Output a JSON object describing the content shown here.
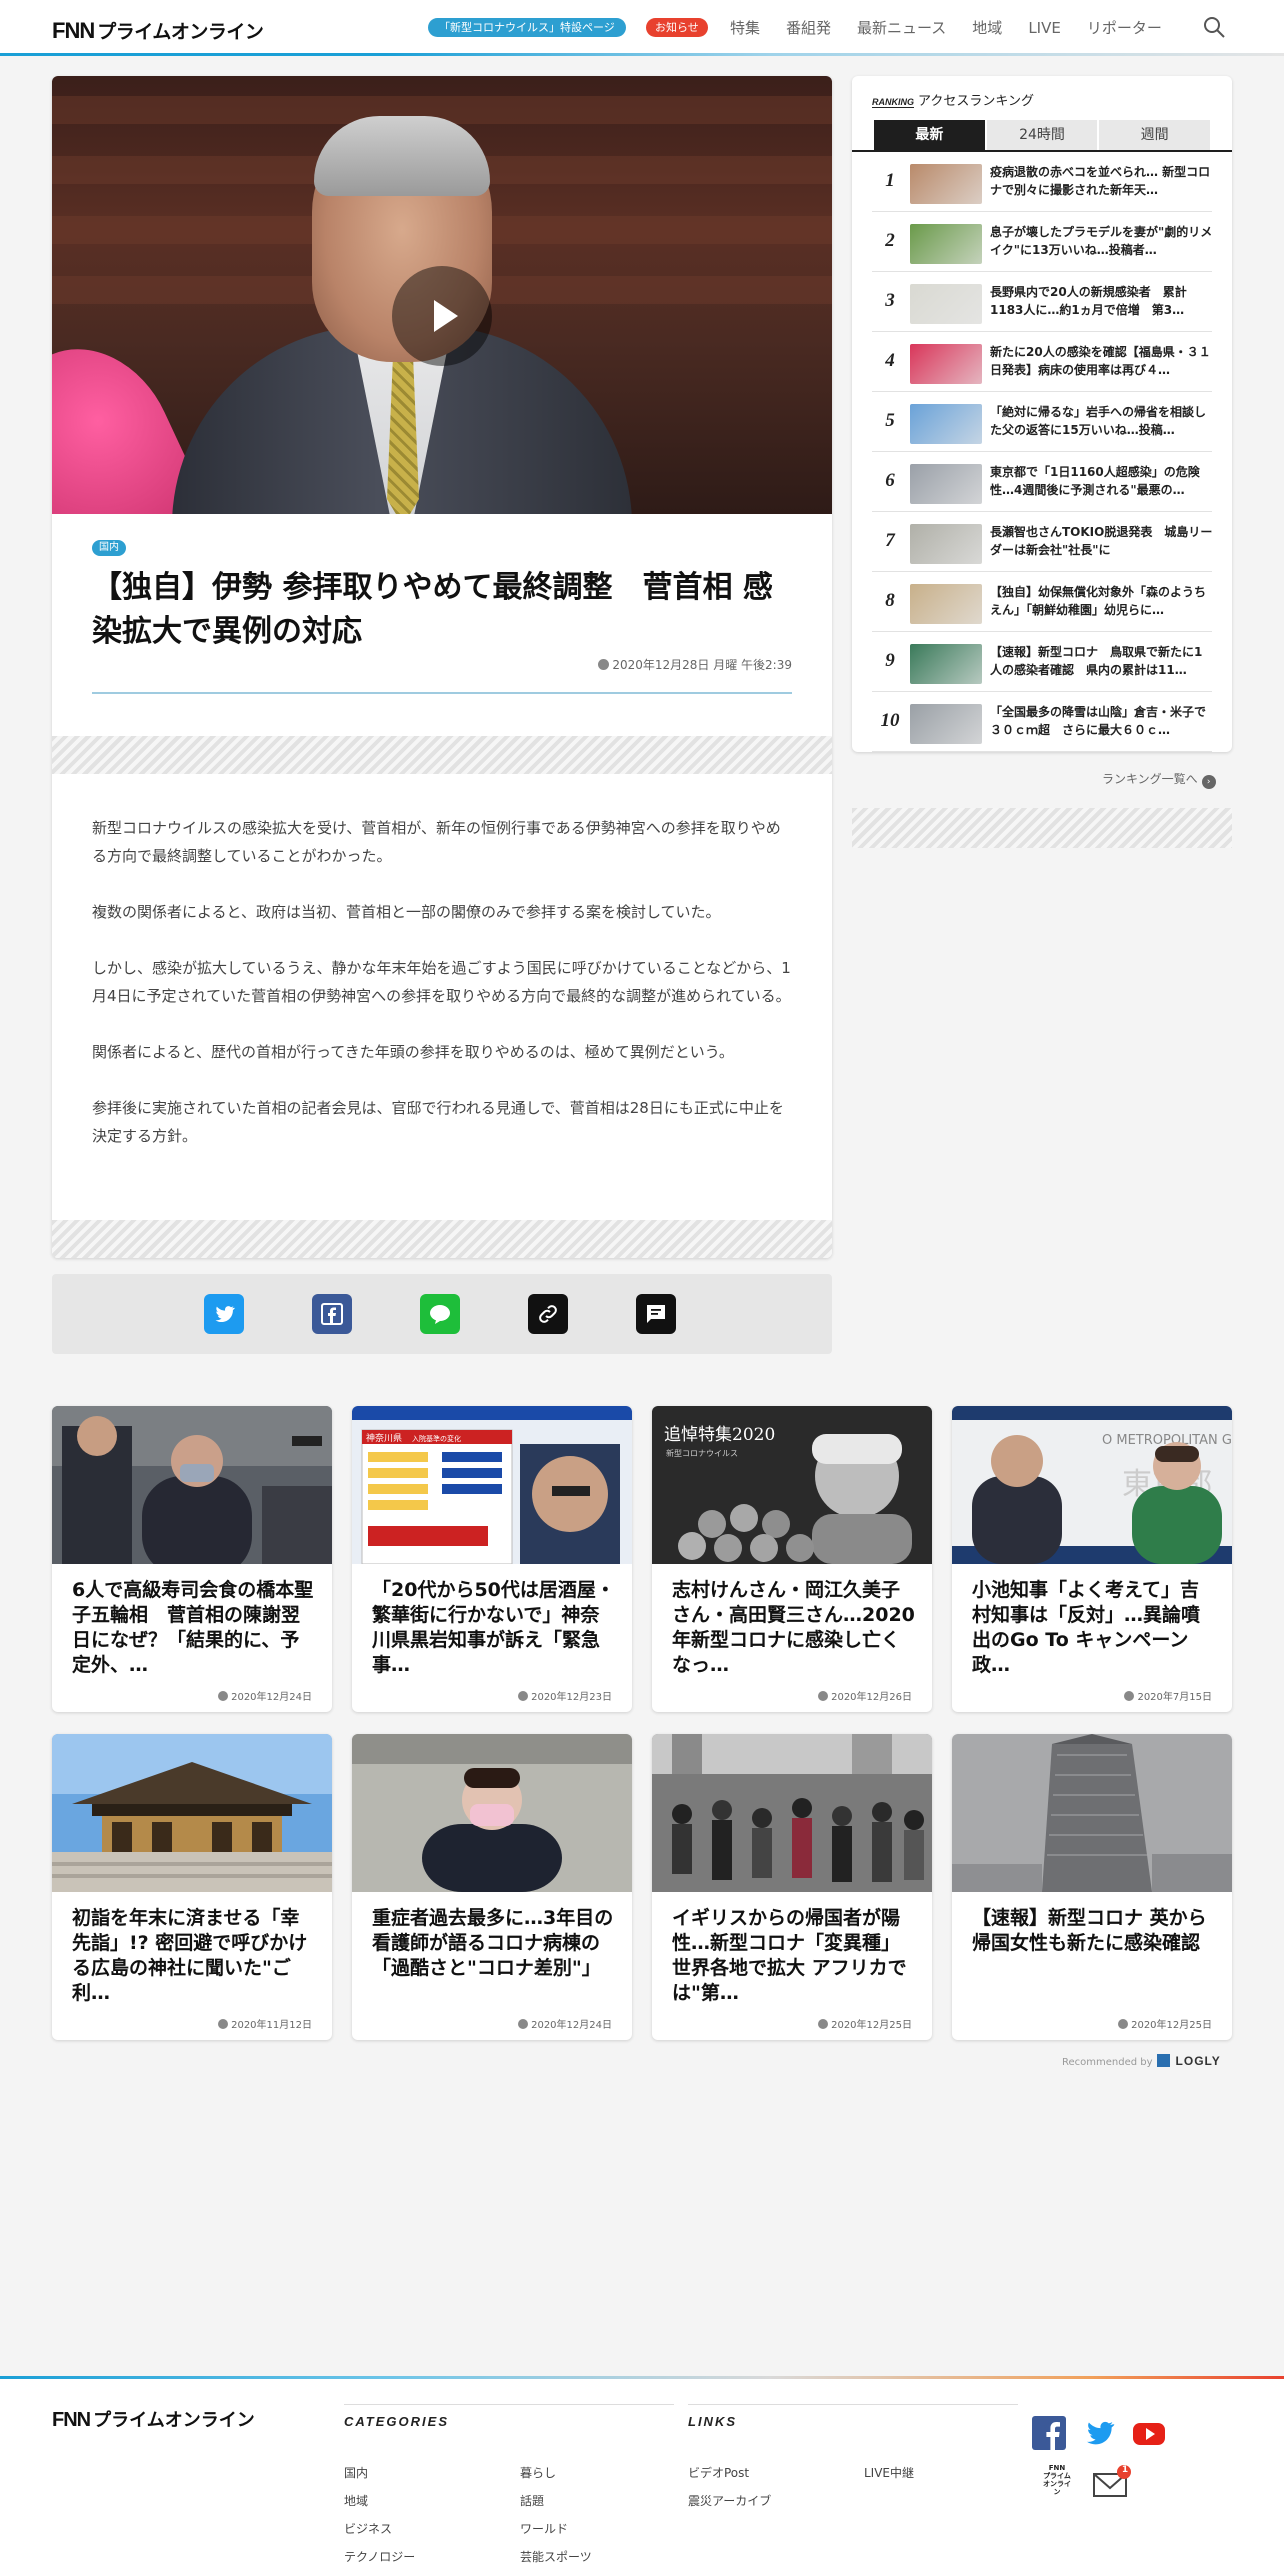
{
  "header": {
    "logo_text": "プライムオンライン",
    "logo_mark": "FNN",
    "corona_pill": "「新型コロナウイルス」特設ページ",
    "notice_pill": "お知らせ",
    "nav": [
      "特集",
      "番組発",
      "最新ニュース",
      "地域",
      "LIVE",
      "リポーター"
    ]
  },
  "article": {
    "category": "国内",
    "title": "【独自】伊勢 参拝取りやめて最終調整　菅首相 感染拡大で異例の対応",
    "date": "2020年12月28日 月曜 午後2:39",
    "paragraphs": [
      "新型コロナウイルスの感染拡大を受け、菅首相が、新年の恒例行事である伊勢神宮への参拝を取りやめる方向で最終調整していることがわかった。",
      "複数の関係者によると、政府は当初、菅首相と一部の閣僚のみで参拝する案を検討していた。",
      "しかし、感染が拡大しているうえ、静かな年末年始を過ごすよう国民に呼びかけていることなどから、1月4日に予定されていた菅首相の伊勢神宮への参拝を取りやめる方向で最終的な調整が進められている。",
      "関係者によると、歴代の首相が行ってきた年頭の参拝を取りやめるのは、極めて異例だという。",
      "参拝後に実施されていた首相の記者会見は、官邸で行われる見通しで、菅首相は28日にも正式に中止を決定する方針。"
    ]
  },
  "ranking": {
    "label_mark": "RANKING",
    "label": "アクセスランキング",
    "tabs": [
      "最新",
      "24時間",
      "週間"
    ],
    "items": [
      {
        "num": "1",
        "text": "疫病退散の赤べコを並べられ… 新型コロナで別々に撮影された新年天…",
        "thumb": "#b98a6a"
      },
      {
        "num": "2",
        "text": "息子が壊したプラモデルを妻が\"劇的リメイク\"に13万いいね…投稿者…",
        "thumb": "#6a9a4a"
      },
      {
        "num": "3",
        "text": "長野県内で20人の新規感染者　累計1183人に…約1ヵ月で倍増　第3…",
        "thumb": "#d9d9d2"
      },
      {
        "num": "4",
        "text": "新たに20人の感染を確認【福島県・３１日発表】病床の使用率は再び４…",
        "thumb": "#d9365a"
      },
      {
        "num": "5",
        "text": "「絶対に帰るな」岩手への帰省を相談した父の返答に15万いいね…投稿…",
        "thumb": "#6aa2d8"
      },
      {
        "num": "6",
        "text": "東京都で「1日1160人超感染」の危険性…4週間後に予測される\"最悪の…",
        "thumb": "#9aa0a8"
      },
      {
        "num": "7",
        "text": "長瀬智也さんTOKIO脱退発表　城島リーダーは新会社\"社長\"に",
        "thumb": "#b0b0a8"
      },
      {
        "num": "8",
        "text": "【独自】幼保無償化対象外「森のようちえん」「朝鮮幼稚園」幼児らに…",
        "thumb": "#c8b08a"
      },
      {
        "num": "9",
        "text": "【速報】新型コロナ　鳥取県で新たに1人の感染者確認　県内の累計は11…",
        "thumb": "#3a7a5a"
      },
      {
        "num": "10",
        "text": "「全国最多の降雪は山陰」倉吉・米子で３０ｃｍ超　さらに最大６０ｃ…",
        "thumb": "#9aa0a6"
      }
    ],
    "more": "ランキング一覧へ"
  },
  "recommended": [
    {
      "title": "6人で高級寿司会食の橋本聖子五輪相　菅首相の陳謝翌日になぜ？「結果的に、予定外、…",
      "date": "2020年12月24日"
    },
    {
      "title": "「20代から50代は居酒屋・繁華街に行かないで」神奈川県黒岩知事が訴え「緊急事…",
      "date": "2020年12月23日"
    },
    {
      "title": "志村けんさん・岡江久美子さん・高田賢三さん…2020年新型コロナに感染し亡くなっ…",
      "date": "2020年12月26日"
    },
    {
      "title": "小池知事「よく考えて」吉村知事は「反対」…異論噴出のGo To キャンペーン政…",
      "date": "2020年7月15日"
    },
    {
      "title": "初詣を年末に済ませる「幸先詣」!? 密回避で呼びかける広島の神社に聞いた\"ご利…",
      "date": "2020年11月12日"
    },
    {
      "title": "重症者過去最多に…3年目の看護師が語るコロナ病棟の「過酷さと\"コロナ差別\"」",
      "date": "2020年12月24日"
    },
    {
      "title": "イギリスからの帰国者が陽性…新型コロナ「変異種」世界各地で拡大 アフリカでは\"第…",
      "date": "2020年12月25日"
    },
    {
      "title": "【速報】新型コロナ 英から帰国女性も新たに感染確認",
      "date": "2020年12月25日"
    }
  ],
  "recommended_by": {
    "label": "Recommended by",
    "brand": "LOGLY"
  },
  "rec_image_text": {
    "card2_header": "神奈川県",
    "card2_header_sub": "入院基準の変化",
    "card3_title": "追悼特集2020",
    "card3_sub": "新型コロナウイルス",
    "card4_banner": "O METROPOLITAN G",
    "card4_sign": "東京都"
  },
  "footer": {
    "logo_mark": "FNN",
    "logo_text": "プライムオンライン",
    "categories_title": "CATEGORIES",
    "links_title": "LINKS",
    "categories": [
      "国内",
      "暮らし",
      "地域",
      "話題",
      "ビジネス",
      "ワールド",
      "テクノロジー",
      "芸能スポーツ"
    ],
    "links": [
      "ビデオPost",
      "LIVE中継",
      "震災アーカイブ"
    ],
    "app_label_1": "FNN",
    "app_label_2": "プライム",
    "app_label_3": "オンライン",
    "mail_badge": "1"
  }
}
